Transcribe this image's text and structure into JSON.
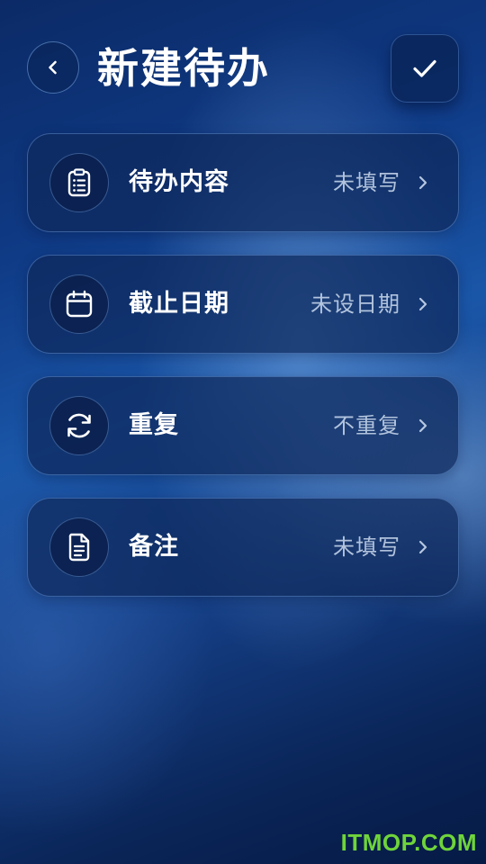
{
  "header": {
    "title": "新建待办",
    "back_icon": "chevron-left-icon",
    "confirm_icon": "check-icon"
  },
  "items": [
    {
      "icon": "clipboard-list-icon",
      "label": "待办内容",
      "value": "未填写"
    },
    {
      "icon": "calendar-icon",
      "label": "截止日期",
      "value": "未设日期"
    },
    {
      "icon": "repeat-icon",
      "label": "重复",
      "value": "不重复"
    },
    {
      "icon": "note-icon",
      "label": "备注",
      "value": "未填写"
    }
  ],
  "watermark": "ITMOP.COM",
  "colors": {
    "accent": "#1a56a8",
    "watermark": "#6fd43a"
  }
}
